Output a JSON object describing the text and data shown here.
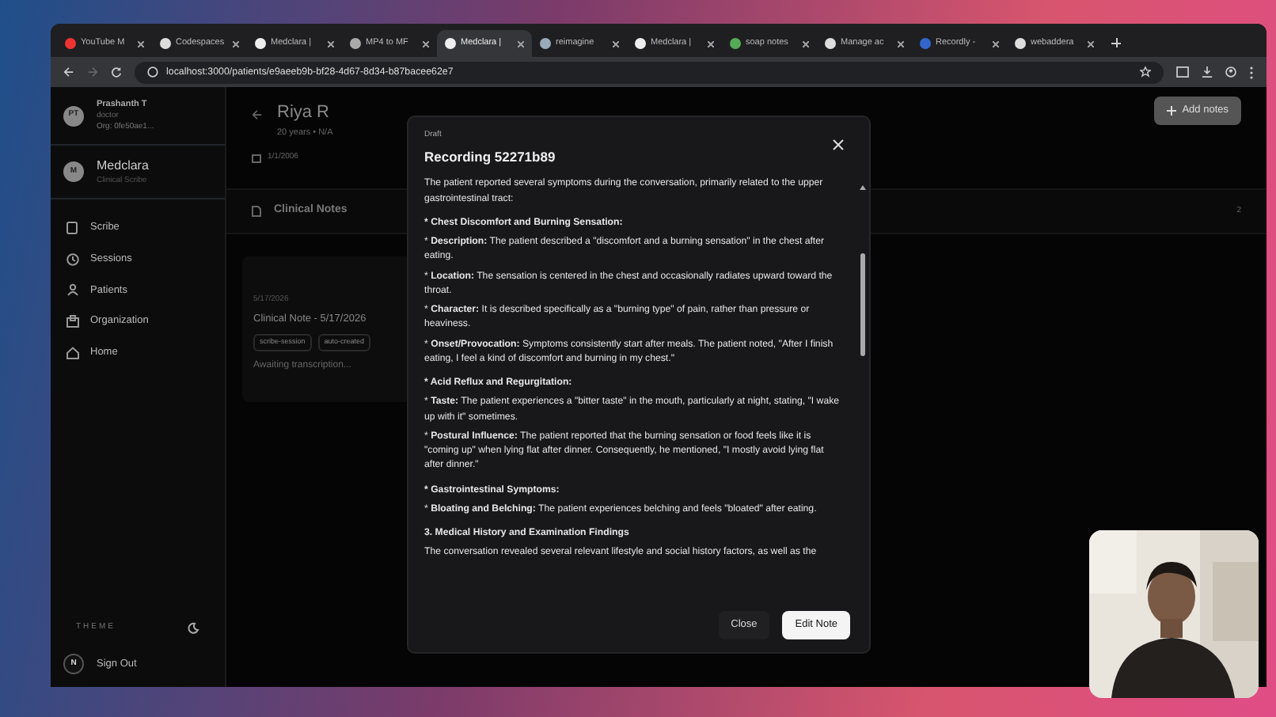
{
  "browser": {
    "tabs": [
      {
        "label": "YouTube M",
        "selected": false
      },
      {
        "label": "Codespaces",
        "selected": false
      },
      {
        "label": "Medclara |",
        "selected": false
      },
      {
        "label": "MP4 to MF",
        "selected": false
      },
      {
        "label": "Medclara |",
        "selected": true
      },
      {
        "label": "reimagine",
        "selected": false
      },
      {
        "label": "Medclara |",
        "selected": false
      },
      {
        "label": "soap notes",
        "selected": false
      },
      {
        "label": "Manage ac",
        "selected": false
      },
      {
        "label": "Recordly -",
        "selected": false
      },
      {
        "label": "webaddera",
        "selected": false
      }
    ],
    "url": "localhost:3000/patients/e9aeeb9b-bf28-4d67-8d34-b87bacee62e7"
  },
  "sidebar": {
    "user": {
      "initials": "PT",
      "name": "Prashanth T",
      "role": "doctor",
      "org": "Org: 0fe50ae1..."
    },
    "app": {
      "initial": "M",
      "name": "Medclara",
      "subtitle": "Clinical Scribe"
    },
    "items": [
      "Scribe",
      "Sessions",
      "Patients",
      "Organization",
      "Home"
    ],
    "theme_label": "THEME",
    "sign_out": {
      "initial": "N",
      "label": "Sign Out"
    }
  },
  "patient": {
    "name": "Riya R",
    "meta": "20 years • N/A",
    "dob": "1/1/2006",
    "add_button": "Add notes"
  },
  "notes": {
    "title": "Clinical Notes",
    "count": "2",
    "card": {
      "date": "5/17/2026",
      "title": "Clinical Note - 5/17/2026",
      "tags": [
        "scribe-session",
        "auto-created"
      ],
      "status": "Awaiting transcription..."
    }
  },
  "modal": {
    "status": "Draft",
    "title": "Recording 52271b89",
    "blocks": [
      {
        "kind": "paragraph",
        "text": "The patient reported several symptoms during the conversation, primarily related to the upper gastrointestinal tract:"
      },
      {
        "kind": "heading",
        "text": "* Chest Discomfort and Burning Sensation:"
      },
      {
        "kind": "item",
        "text": "* **Description:** The patient described a \"discomfort and a burning sensation\" in the chest after eating."
      },
      {
        "kind": "item",
        "text": "* **Location:** The sensation is centered in the chest and occasionally radiates upward toward the throat."
      },
      {
        "kind": "item",
        "text": "* **Character:** It is described specifically as a \"burning type\" of pain, rather than pressure or heaviness."
      },
      {
        "kind": "item",
        "text": "* **Onset/Provocation:** Symptoms consistently start after meals. The patient noted, \"After I finish eating, I feel a kind of discomfort and burning in my chest.\""
      },
      {
        "kind": "heading",
        "text": "* Acid Reflux and Regurgitation:"
      },
      {
        "kind": "item",
        "text": "* **Taste:** The patient experiences a \"bitter taste\" in the mouth, particularly at night, stating, \"I wake up with it\" sometimes."
      },
      {
        "kind": "item",
        "text": "* **Postural Influence:** The patient reported that the burning sensation or food feels like it is \"coming up\" when lying flat after dinner. Consequently, he mentioned, \"I mostly avoid lying flat after dinner.\""
      },
      {
        "kind": "heading",
        "text": "* Gastrointestinal Symptoms:"
      },
      {
        "kind": "item",
        "text": "* **Bloating and Belching:** The patient experiences belching and feels \"bloated\" after eating."
      },
      {
        "kind": "heading",
        "text": "3. Medical History and Examination Findings"
      },
      {
        "kind": "paragraph",
        "text": "The conversation revealed several relevant lifestyle and social history factors, as well as the"
      }
    ],
    "buttons": [
      {
        "label": "Close",
        "kind": "secondary"
      },
      {
        "label": "Edit Note",
        "kind": "primary"
      }
    ]
  }
}
